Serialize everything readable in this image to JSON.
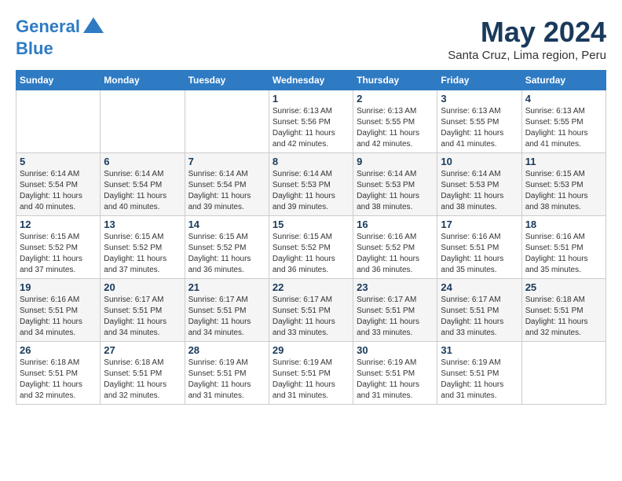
{
  "header": {
    "logo_line1": "General",
    "logo_line2": "Blue",
    "month_title": "May 2024",
    "location": "Santa Cruz, Lima region, Peru"
  },
  "weekdays": [
    "Sunday",
    "Monday",
    "Tuesday",
    "Wednesday",
    "Thursday",
    "Friday",
    "Saturday"
  ],
  "weeks": [
    [
      {
        "day": "",
        "info": ""
      },
      {
        "day": "",
        "info": ""
      },
      {
        "day": "",
        "info": ""
      },
      {
        "day": "1",
        "info": "Sunrise: 6:13 AM\nSunset: 5:56 PM\nDaylight: 11 hours\nand 42 minutes."
      },
      {
        "day": "2",
        "info": "Sunrise: 6:13 AM\nSunset: 5:55 PM\nDaylight: 11 hours\nand 42 minutes."
      },
      {
        "day": "3",
        "info": "Sunrise: 6:13 AM\nSunset: 5:55 PM\nDaylight: 11 hours\nand 41 minutes."
      },
      {
        "day": "4",
        "info": "Sunrise: 6:13 AM\nSunset: 5:55 PM\nDaylight: 11 hours\nand 41 minutes."
      }
    ],
    [
      {
        "day": "5",
        "info": "Sunrise: 6:14 AM\nSunset: 5:54 PM\nDaylight: 11 hours\nand 40 minutes."
      },
      {
        "day": "6",
        "info": "Sunrise: 6:14 AM\nSunset: 5:54 PM\nDaylight: 11 hours\nand 40 minutes."
      },
      {
        "day": "7",
        "info": "Sunrise: 6:14 AM\nSunset: 5:54 PM\nDaylight: 11 hours\nand 39 minutes."
      },
      {
        "day": "8",
        "info": "Sunrise: 6:14 AM\nSunset: 5:53 PM\nDaylight: 11 hours\nand 39 minutes."
      },
      {
        "day": "9",
        "info": "Sunrise: 6:14 AM\nSunset: 5:53 PM\nDaylight: 11 hours\nand 38 minutes."
      },
      {
        "day": "10",
        "info": "Sunrise: 6:14 AM\nSunset: 5:53 PM\nDaylight: 11 hours\nand 38 minutes."
      },
      {
        "day": "11",
        "info": "Sunrise: 6:15 AM\nSunset: 5:53 PM\nDaylight: 11 hours\nand 38 minutes."
      }
    ],
    [
      {
        "day": "12",
        "info": "Sunrise: 6:15 AM\nSunset: 5:52 PM\nDaylight: 11 hours\nand 37 minutes."
      },
      {
        "day": "13",
        "info": "Sunrise: 6:15 AM\nSunset: 5:52 PM\nDaylight: 11 hours\nand 37 minutes."
      },
      {
        "day": "14",
        "info": "Sunrise: 6:15 AM\nSunset: 5:52 PM\nDaylight: 11 hours\nand 36 minutes."
      },
      {
        "day": "15",
        "info": "Sunrise: 6:15 AM\nSunset: 5:52 PM\nDaylight: 11 hours\nand 36 minutes."
      },
      {
        "day": "16",
        "info": "Sunrise: 6:16 AM\nSunset: 5:52 PM\nDaylight: 11 hours\nand 36 minutes."
      },
      {
        "day": "17",
        "info": "Sunrise: 6:16 AM\nSunset: 5:51 PM\nDaylight: 11 hours\nand 35 minutes."
      },
      {
        "day": "18",
        "info": "Sunrise: 6:16 AM\nSunset: 5:51 PM\nDaylight: 11 hours\nand 35 minutes."
      }
    ],
    [
      {
        "day": "19",
        "info": "Sunrise: 6:16 AM\nSunset: 5:51 PM\nDaylight: 11 hours\nand 34 minutes."
      },
      {
        "day": "20",
        "info": "Sunrise: 6:17 AM\nSunset: 5:51 PM\nDaylight: 11 hours\nand 34 minutes."
      },
      {
        "day": "21",
        "info": "Sunrise: 6:17 AM\nSunset: 5:51 PM\nDaylight: 11 hours\nand 34 minutes."
      },
      {
        "day": "22",
        "info": "Sunrise: 6:17 AM\nSunset: 5:51 PM\nDaylight: 11 hours\nand 33 minutes."
      },
      {
        "day": "23",
        "info": "Sunrise: 6:17 AM\nSunset: 5:51 PM\nDaylight: 11 hours\nand 33 minutes."
      },
      {
        "day": "24",
        "info": "Sunrise: 6:17 AM\nSunset: 5:51 PM\nDaylight: 11 hours\nand 33 minutes."
      },
      {
        "day": "25",
        "info": "Sunrise: 6:18 AM\nSunset: 5:51 PM\nDaylight: 11 hours\nand 32 minutes."
      }
    ],
    [
      {
        "day": "26",
        "info": "Sunrise: 6:18 AM\nSunset: 5:51 PM\nDaylight: 11 hours\nand 32 minutes."
      },
      {
        "day": "27",
        "info": "Sunrise: 6:18 AM\nSunset: 5:51 PM\nDaylight: 11 hours\nand 32 minutes."
      },
      {
        "day": "28",
        "info": "Sunrise: 6:19 AM\nSunset: 5:51 PM\nDaylight: 11 hours\nand 31 minutes."
      },
      {
        "day": "29",
        "info": "Sunrise: 6:19 AM\nSunset: 5:51 PM\nDaylight: 11 hours\nand 31 minutes."
      },
      {
        "day": "30",
        "info": "Sunrise: 6:19 AM\nSunset: 5:51 PM\nDaylight: 11 hours\nand 31 minutes."
      },
      {
        "day": "31",
        "info": "Sunrise: 6:19 AM\nSunset: 5:51 PM\nDaylight: 11 hours\nand 31 minutes."
      },
      {
        "day": "",
        "info": ""
      }
    ]
  ]
}
